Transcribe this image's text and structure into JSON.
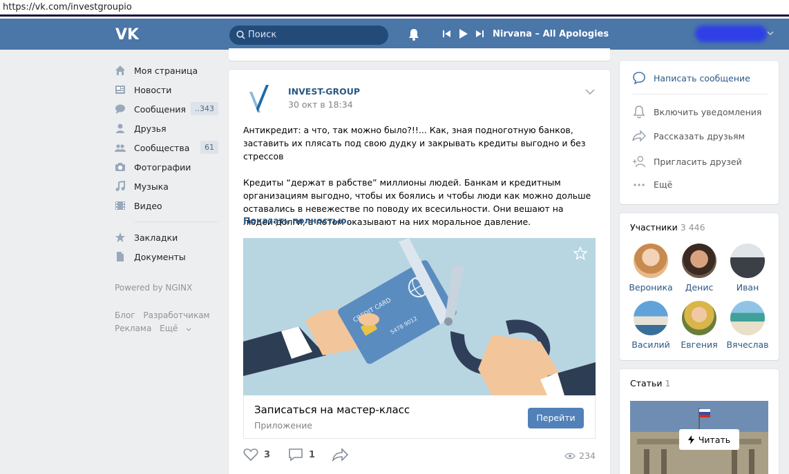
{
  "browser": {
    "url": "https://vk.com/investgroupio"
  },
  "header": {
    "search_placeholder": "Поиск",
    "track": "Nirvana – All Apologies"
  },
  "nav": {
    "items": [
      {
        "label": "Моя страница",
        "icon": "home-icon"
      },
      {
        "label": "Новости",
        "icon": "news-icon"
      },
      {
        "label": "Сообщения",
        "icon": "messages-icon",
        "count": "..343"
      },
      {
        "label": "Друзья",
        "icon": "friends-icon"
      },
      {
        "label": "Сообщества",
        "icon": "groups-icon",
        "count": "61"
      },
      {
        "label": "Фотографии",
        "icon": "camera-icon"
      },
      {
        "label": "Музыка",
        "icon": "music-icon"
      },
      {
        "label": "Видео",
        "icon": "video-icon"
      }
    ],
    "secondary": [
      {
        "label": "Закладки",
        "icon": "star-icon"
      },
      {
        "label": "Документы",
        "icon": "document-icon"
      }
    ],
    "powered": "Powered by NGINX",
    "footer": [
      "Блог",
      "Разработчикам",
      "Реклама",
      "Ещё"
    ]
  },
  "post": {
    "author": "INVEST-GROUP",
    "date": "30 окт в 18:34",
    "paragraph1": "Антикредит: а что, так можно было?!!... Как, зная подноготную банков, заставить их плясать под свою дудку и закрывать кредиты выгодно и без стрессов",
    "paragraph2": "Кредиты “держат в рабстве” миллионы людей. Банкам и кредитным организациям выгодно, чтобы их боялись и чтобы люди как можно дольше оставались в невежестве по поводу их всесильности. Они вешают на людей долги, а потом оказывают на них моральное давление.",
    "show_more": "Показать полностью…",
    "card_text": "CREDIT CARD",
    "card_number": "5478 9012",
    "snippet_title": "Записаться на мастер-класс",
    "snippet_sub": "Приложение",
    "snippet_button": "Перейти",
    "likes": "3",
    "comments": "1",
    "views": "234"
  },
  "actions": {
    "write": "Написать сообщение",
    "notify": "Включить уведомления",
    "share": "Рассказать друзьям",
    "invite": "Пригласить друзей",
    "more": "Ещё"
  },
  "members": {
    "title": "Участники",
    "count": "3 446",
    "list": [
      "Вероника",
      "Денис",
      "Иван",
      "Василий",
      "Евгения",
      "Вячеслав"
    ]
  },
  "articles": {
    "title": "Статьи",
    "count": "1",
    "read": "Читать"
  },
  "colors": {
    "header": "#4a76a8",
    "link": "#2a5885",
    "button": "#5181b8"
  }
}
